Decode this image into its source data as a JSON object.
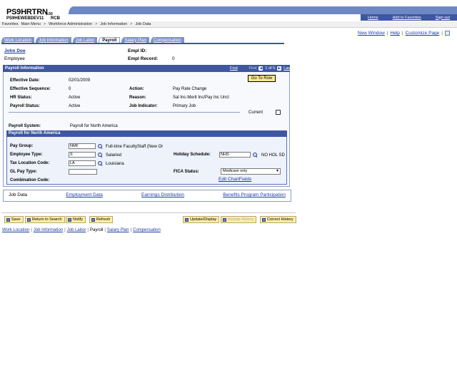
{
  "header": {
    "title": "PS9HRTRN",
    "version": "8.50",
    "database": "PS9HEWEBDEV11",
    "user": "RCB",
    "links": [
      "Home",
      "Add to Favorites",
      "Sign out"
    ]
  },
  "breadcrumb": [
    "Favorites",
    "Main Menu",
    ">",
    "Workforce Administration",
    ">",
    "Job Information",
    ">",
    "Job Data"
  ],
  "page_links": [
    "New Window",
    "Help",
    "Customize Page"
  ],
  "tabs": [
    {
      "label": "Work Location",
      "active": false
    },
    {
      "label": "Job Information",
      "active": false
    },
    {
      "label": "Job Labor",
      "active": false
    },
    {
      "label": "Payroll",
      "active": true
    },
    {
      "label": "Salary Plan",
      "active": false
    },
    {
      "label": "Compensation",
      "active": false
    }
  ],
  "employee": {
    "name": "John Doe",
    "role": "Employee",
    "empl_id_label": "Empl ID:",
    "empl_record_label": "Empl Record:",
    "empl_record_value": "0"
  },
  "payroll_info": {
    "title": "Payroll Information",
    "nav": {
      "find": "Find",
      "first": "First",
      "prev": "◀",
      "count": "1 of 5",
      "next": "▶",
      "last": "Last"
    },
    "go_to_row": "Go To Row",
    "fields": {
      "effective_date_label": "Effective Date:",
      "effective_date": "02/01/2009",
      "effective_sequence_label": "Effective Sequence:",
      "effective_sequence": "0",
      "hr_status_label": "HR Status:",
      "hr_status": "Active",
      "payroll_status_label": "Payroll Status:",
      "payroll_status": "Active",
      "action_label": "Action:",
      "action": "Pay Rate Change",
      "reason_label": "Reason:",
      "reason": "Sal Inc-Merit Inc/Pay Inc Uncl",
      "job_indicator_label": "Job Indicator:",
      "job_indicator": "Primary Job",
      "current_label": "Current",
      "payroll_system_label": "Payroll System:",
      "payroll_system": "Payroll for North America"
    }
  },
  "payroll_na": {
    "title": "Payroll for North America",
    "pay_group_label": "Pay Group:",
    "pay_group": "NMF",
    "pay_group_desc": "Full-time FacultyStaff (New Or",
    "employee_type_label": "Employee Type:",
    "employee_type": "S",
    "employee_type_desc": "Salaried",
    "tax_location_label": "Tax Location Code:",
    "tax_location": "LA",
    "tax_location_desc": "Louisiana",
    "gl_pay_type_label": "GL Pay Type:",
    "gl_pay_type": "",
    "combination_code_label": "Combination Code:",
    "holiday_schedule_label": "Holiday Schedule:",
    "holiday_schedule": "NHS",
    "holiday_schedule_desc": "NO HOL SD",
    "fica_status_label": "FICA Status:",
    "fica_status": "Medicare only",
    "edit_chartfields": "Edit ChartFields"
  },
  "bottom_box_links": [
    "Job Data",
    "Employment Data",
    "Earnings Distribution",
    "Benefits Program Participation"
  ],
  "toolbar": {
    "save": "Save",
    "return_to_search": "Return to Search",
    "notify": "Notify",
    "refresh": "Refresh",
    "update_display": "Update/Display",
    "include_history": "Include History",
    "correct_history": "Correct History"
  },
  "bottom_links": [
    "Work Location",
    "Job Information",
    "Job Labor",
    "Payroll",
    "Salary Plan",
    "Compensation"
  ]
}
